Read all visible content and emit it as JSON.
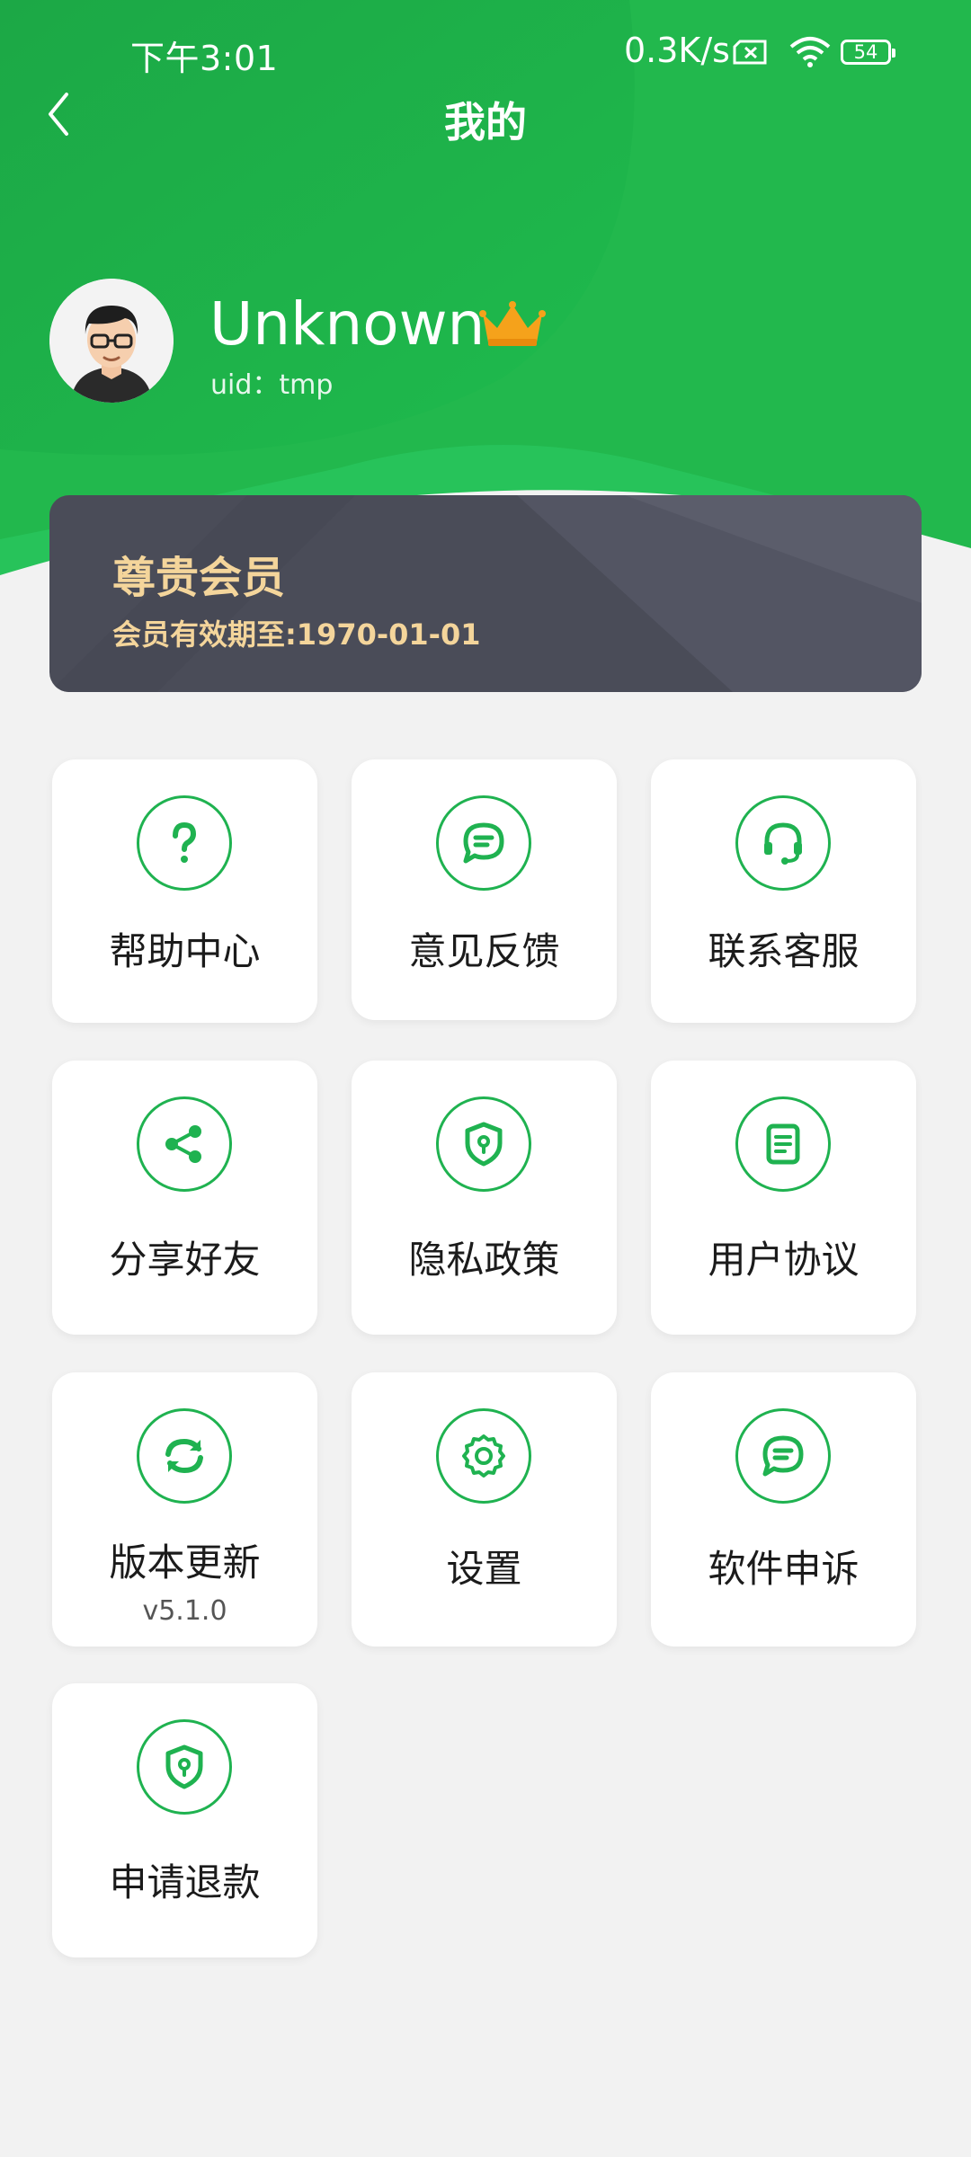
{
  "status_bar": {
    "time": "下午3:01",
    "network_speed": "0.3K/s",
    "battery": "54",
    "icons": [
      "sim-error-icon",
      "wifi-icon",
      "battery-icon"
    ]
  },
  "nav": {
    "title": "我的",
    "back_icon": "chevron-left-icon"
  },
  "profile": {
    "username": "Unknown",
    "uid": "uid：tmp",
    "badge_icon": "crown-icon"
  },
  "vip": {
    "title": "尊贵会员",
    "expiry": "会员有效期至:1970-01-01"
  },
  "menu": {
    "help": {
      "label": "帮助中心",
      "icon": "question-icon"
    },
    "feedback": {
      "label": "意见反馈",
      "icon": "chat-bubble-icon"
    },
    "contact": {
      "label": "联系客服",
      "icon": "headset-icon"
    },
    "share": {
      "label": "分享好友",
      "icon": "share-icon"
    },
    "privacy": {
      "label": "隐私政策",
      "icon": "shield-lock-icon"
    },
    "agreement": {
      "label": "用户协议",
      "icon": "document-icon"
    },
    "update": {
      "label": "版本更新",
      "sub": "v5.1.0",
      "icon": "refresh-icon"
    },
    "settings": {
      "label": "设置",
      "icon": "gear-icon"
    },
    "appeal": {
      "label": "软件申诉",
      "icon": "chat-bubble-icon"
    },
    "refund": {
      "label": "申请退款",
      "icon": "shield-lock-icon"
    }
  },
  "colors": {
    "brand_green": "#1fb250",
    "header_green": "#22b84a",
    "vip_gold": "#f4d59b",
    "vip_card": "#4a4c58",
    "background": "#f2f2f2"
  }
}
